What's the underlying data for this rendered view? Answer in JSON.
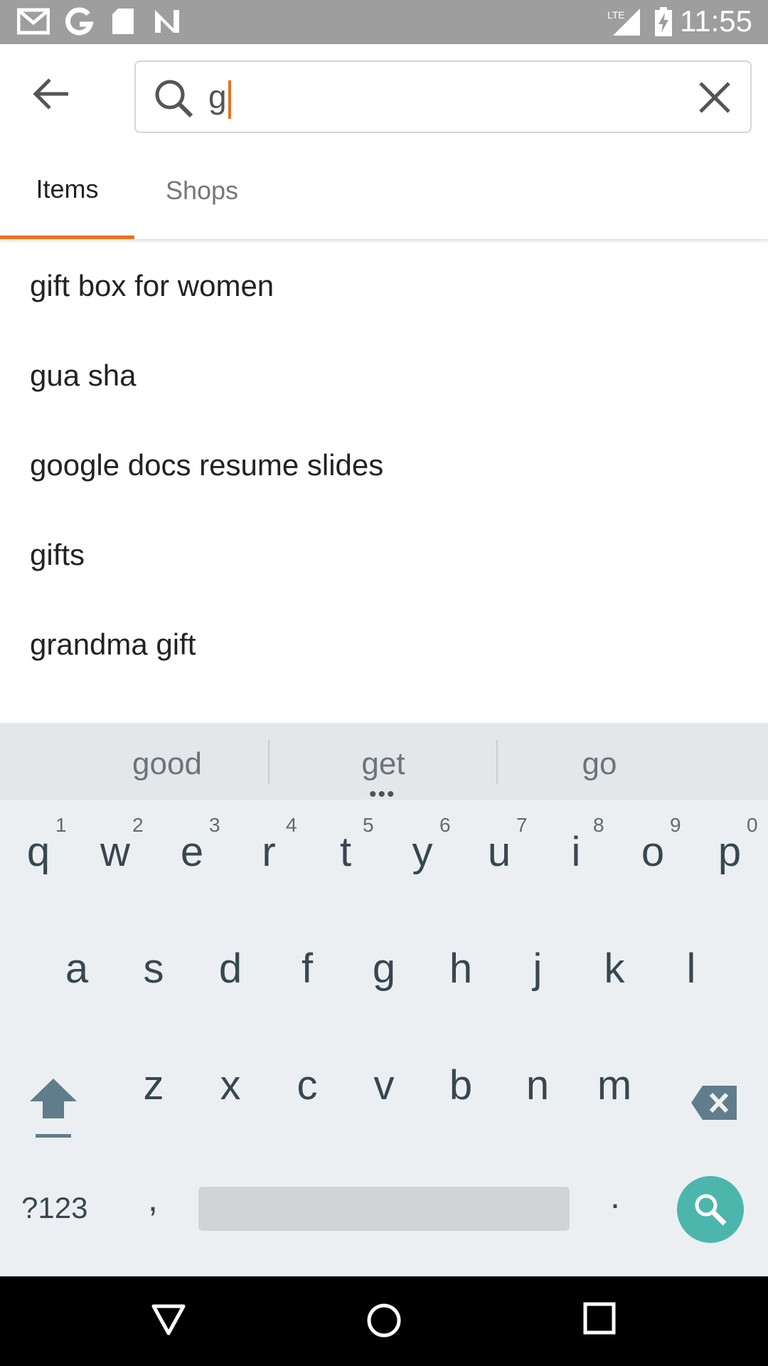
{
  "status_bar": {
    "time": "11:55",
    "network_label": "LTE"
  },
  "search": {
    "value": "g"
  },
  "tabs": [
    {
      "label": "Items"
    },
    {
      "label": "Shops"
    }
  ],
  "suggestions": [
    {
      "text": "gift box for women"
    },
    {
      "text": "gua sha"
    },
    {
      "text": "google docs resume slides"
    },
    {
      "text": "gifts"
    },
    {
      "text": "grandma gift"
    }
  ],
  "keyboard": {
    "predictions": [
      "good",
      "get",
      "go"
    ],
    "row1": [
      {
        "key": "q",
        "hint": "1"
      },
      {
        "key": "w",
        "hint": "2"
      },
      {
        "key": "e",
        "hint": "3"
      },
      {
        "key": "r",
        "hint": "4"
      },
      {
        "key": "t",
        "hint": "5"
      },
      {
        "key": "y",
        "hint": "6"
      },
      {
        "key": "u",
        "hint": "7"
      },
      {
        "key": "i",
        "hint": "8"
      },
      {
        "key": "o",
        "hint": "9"
      },
      {
        "key": "p",
        "hint": "0"
      }
    ],
    "row2": [
      "a",
      "s",
      "d",
      "f",
      "g",
      "h",
      "j",
      "k",
      "l"
    ],
    "row3": [
      "z",
      "x",
      "c",
      "v",
      "b",
      "n",
      "m"
    ],
    "symbols_label": "?123",
    "comma": ",",
    "period": "."
  },
  "colors": {
    "accent": "#e8721d",
    "keyboard_action": "#4db6ac",
    "status_bar": "#9e9e9e"
  }
}
